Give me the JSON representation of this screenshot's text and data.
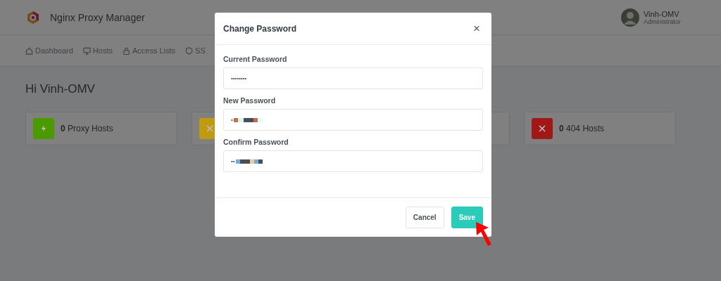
{
  "app": {
    "title": "Nginx Proxy Manager"
  },
  "user": {
    "name": "Vinh-OMV",
    "role": "Administrator"
  },
  "nav": [
    {
      "label": "Dashboard"
    },
    {
      "label": "Hosts"
    },
    {
      "label": "Access Lists"
    },
    {
      "label": "SS"
    }
  ],
  "greeting": "Hi Vinh-OMV",
  "stats": [
    {
      "kind": "stat",
      "count": "0",
      "label": "Proxy Hosts",
      "color": "#4a9a00"
    },
    {
      "kind": "stat",
      "color": "#c09a10"
    },
    {
      "kind": "stat"
    },
    {
      "kind": "stat",
      "count": "0",
      "label": "404 Hosts",
      "color": "#a01818"
    }
  ],
  "dialog": {
    "title": "Change Password",
    "close": "×",
    "fields": [
      {
        "label": "Current Password",
        "value": "••••••••"
      },
      {
        "label": "New Password",
        "value": "•"
      },
      {
        "label": "Confirm Password",
        "value": "••"
      }
    ],
    "buttons": [
      {
        "label": "Cancel",
        "kind": "secondary"
      },
      {
        "label": "Save",
        "kind": "primary"
      }
    ]
  }
}
